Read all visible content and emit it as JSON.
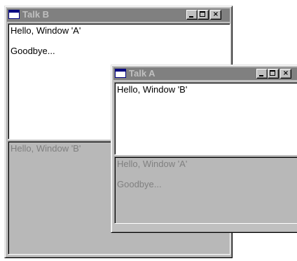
{
  "window_b": {
    "title": "Talk B",
    "buttons": {
      "minimize": "_",
      "maximize": "□",
      "close": "×"
    },
    "top_pane": {
      "line1": "Hello, Window 'A'",
      "line2": "Goodbye..."
    },
    "bottom_pane": {
      "line1": "Hello, Window 'B'"
    }
  },
  "window_a": {
    "title": "Talk A",
    "buttons": {
      "minimize": "_",
      "maximize": "□",
      "close": "×"
    },
    "top_pane": {
      "line1": "Hello, Window 'B'"
    },
    "bottom_pane": {
      "line1": "Hello, Window 'A'",
      "line2": "Goodbye..."
    }
  },
  "colors": {
    "titlebar_inactive": "#808080",
    "title_text_inactive": "#c0c0c0",
    "face": "#c0c0c0",
    "incoming_pane_bg": "#ffffff",
    "outgoing_pane_bg": "#b8b8b8",
    "outgoing_text": "#808080"
  },
  "icons": [
    "window-icon",
    "minimize-icon",
    "maximize-icon",
    "close-icon"
  ]
}
